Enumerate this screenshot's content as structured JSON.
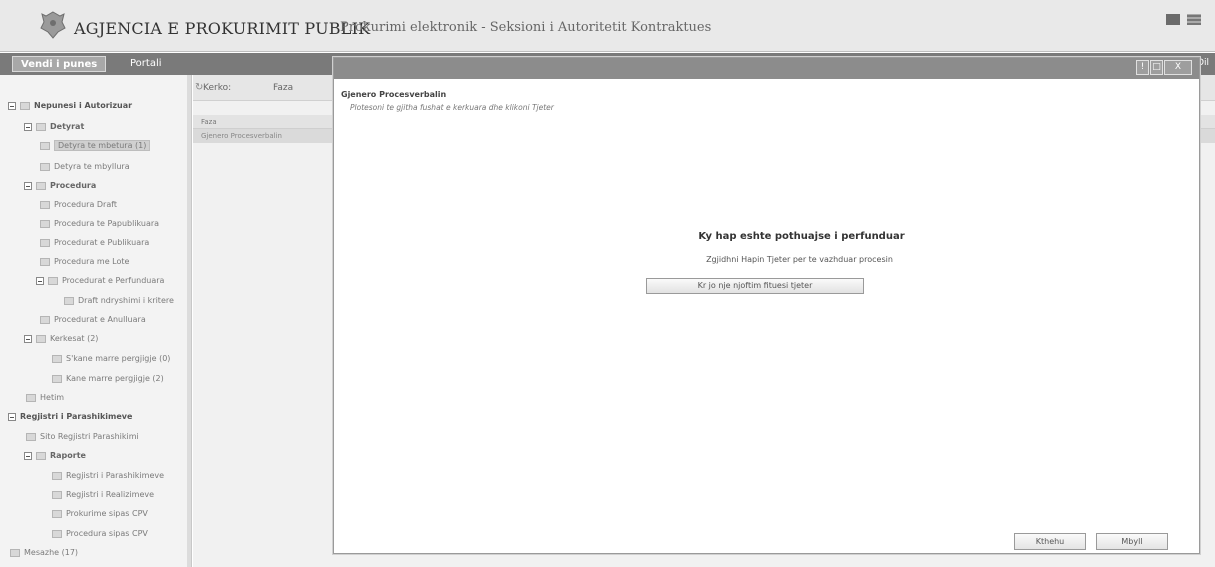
{
  "header": {
    "agency": "AGJENCIA E PROKURIMIT PUBLIK",
    "subtitle": "Prokurimi elektronik - Seksioni i Autoritetit Kontraktues"
  },
  "nav": {
    "tabs": [
      {
        "label": "Vendi i punes"
      },
      {
        "label": "Portali"
      }
    ],
    "right_text": "im Dil"
  },
  "sidebar": {
    "items": [
      {
        "label": "Nepunesi i Autorizuar"
      },
      {
        "label": "Detyrat"
      },
      {
        "label": "Detyra te mbetura (1)"
      },
      {
        "label": "Detyra te mbyllura"
      },
      {
        "label": "Procedura"
      },
      {
        "label": "Procedura Draft"
      },
      {
        "label": "Procedura te Papublikuara"
      },
      {
        "label": "Procedurat e Publikuara"
      },
      {
        "label": "Procedura me Lote"
      },
      {
        "label": "Procedurat e Perfunduara"
      },
      {
        "label": "Draft ndryshimi i kritere"
      },
      {
        "label": "Procedurat e Anulluara"
      },
      {
        "label": "Kerkesat (2)"
      },
      {
        "label": "S'kane marre pergjigje (0)"
      },
      {
        "label": "Kane marre pergjigje (2)"
      },
      {
        "label": "Hetim"
      },
      {
        "label": "Regjistri i Parashikimeve"
      },
      {
        "label": "Sito Regjistri Parashikimi"
      },
      {
        "label": "Raporte"
      },
      {
        "label": "Regjistri i Parashikimeve"
      },
      {
        "label": "Regjistri i Realizimeve"
      },
      {
        "label": "Prokurime sipas CPV"
      },
      {
        "label": "Procedura sipas CPV"
      },
      {
        "label": "Mesazhe (17)"
      }
    ]
  },
  "main": {
    "search_label": "Kerko:",
    "filter_label": "Faza",
    "grid": {
      "column": "Faza",
      "rows": [
        "Gjenero Procesverbalin"
      ]
    }
  },
  "modal": {
    "window_buttons": [
      "!",
      "□",
      "X"
    ],
    "title": "Gjenero Procesverbalin",
    "instruction": "Plotesoni te gjitha fushat e kerkuara dhe klikoni Tjeter",
    "heading": "Ky hap eshte pothuajse i perfunduar",
    "subtext": "Zgjidhni Hapin Tjeter per te vazhduar procesin",
    "action_button": "Kr jo nje njoftim fituesi tjeter",
    "back_button": "Kthehu",
    "close_button": "Mbyll"
  },
  "colors": {
    "header_bg": "#e9e9e9",
    "nav_bg": "#7a7a7a",
    "titlebar_bg": "#8c8c8c",
    "selected_bg": "#d0d0d0"
  }
}
